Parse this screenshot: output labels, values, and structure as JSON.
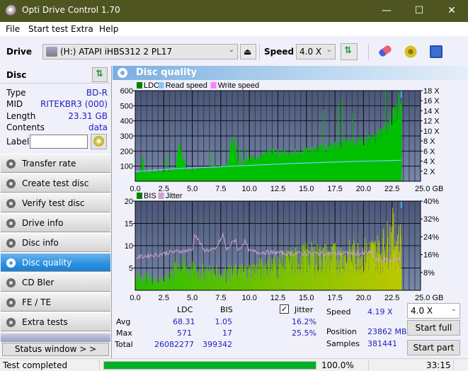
{
  "window": {
    "title": "Opti Drive Control 1.70",
    "controls": [
      "minimize",
      "maximize",
      "close"
    ]
  },
  "menu": [
    "File",
    "Start test",
    "Extra",
    "Help"
  ],
  "toolbar": {
    "drive_label": "Drive",
    "drive_value": "(H:)  ATAPI iHBS312  2 PL17",
    "speed_label": "Speed",
    "speed_value": "4.0 X",
    "icons": [
      "eject-icon",
      "refresh-icon",
      "eraser-icon",
      "config-icon",
      "save-icon"
    ]
  },
  "disc": {
    "title": "Disc",
    "rows": [
      {
        "key": "Type",
        "value": "BD-R"
      },
      {
        "key": "MID",
        "value": "RITEKBR3 (000)"
      },
      {
        "key": "Length",
        "value": "23.31 GB"
      },
      {
        "key": "Contents",
        "value": "data"
      }
    ],
    "label_key": "Label",
    "label_value": ""
  },
  "nav": [
    {
      "label": "Transfer rate",
      "active": false
    },
    {
      "label": "Create test disc",
      "active": false
    },
    {
      "label": "Verify test disc",
      "active": false
    },
    {
      "label": "Drive info",
      "active": false
    },
    {
      "label": "Disc info",
      "active": false
    },
    {
      "label": "Disc quality",
      "active": true
    },
    {
      "label": "CD Bler",
      "active": false
    },
    {
      "label": "FE / TE",
      "active": false
    },
    {
      "label": "Extra tests",
      "active": false
    }
  ],
  "status_window_label": "Status window > >",
  "panel_title": "Disc quality",
  "chart_data": [
    {
      "type": "area",
      "title": "LDC / Read speed",
      "legend": [
        "LDC",
        "Read speed",
        "Write speed"
      ],
      "legend_colors": [
        "#008000",
        "#80c8ff",
        "#ff80ff"
      ],
      "xlabel": "GB",
      "x_ticks": [
        "0.0",
        "2.5",
        "5.0",
        "7.5",
        "10.0",
        "12.5",
        "15.0",
        "17.5",
        "20.0",
        "22.5",
        "25.0 GB"
      ],
      "xlim": [
        0,
        25
      ],
      "y_ticks_left": [
        "100",
        "200",
        "300",
        "400",
        "500",
        "600"
      ],
      "ylim_left": [
        0,
        600
      ],
      "y_ticks_right": [
        "2 X",
        "4 X",
        "6 X",
        "8 X",
        "10 X",
        "12 X",
        "14 X",
        "16 X",
        "18 X"
      ],
      "ylim_right": [
        0,
        18
      ],
      "series": [
        {
          "name": "LDC",
          "x": [
            0,
            0.5,
            0.65,
            0.8,
            1.5,
            2.5,
            3.5,
            3.8,
            4.5,
            5.0,
            6.0,
            7.0,
            8.0,
            8.6,
            9.0,
            9.5,
            10.0,
            11.0,
            12.0,
            12.5,
            13.0,
            14.0,
            15.0,
            16.0,
            17.0,
            18.0,
            19.0,
            20.0,
            21.0,
            21.5,
            22.0,
            22.5,
            23.0,
            23.31
          ],
          "y": [
            55,
            60,
            185,
            60,
            65,
            70,
            80,
            250,
            75,
            80,
            90,
            95,
            105,
            300,
            110,
            130,
            150,
            165,
            200,
            190,
            180,
            190,
            200,
            210,
            225,
            240,
            255,
            270,
            290,
            320,
            340,
            420,
            480,
            571
          ]
        },
        {
          "name": "Read speed",
          "x": [
            0,
            1,
            2,
            3,
            4,
            5,
            6,
            7,
            8,
            9,
            10,
            11,
            12,
            13,
            14,
            15,
            16,
            17,
            18,
            19,
            20,
            21,
            22,
            23,
            23.31
          ],
          "y": [
            1.95,
            2.1,
            2.25,
            2.4,
            2.55,
            2.65,
            2.75,
            2.85,
            2.95,
            3.05,
            3.15,
            3.25,
            3.35,
            3.45,
            3.55,
            3.62,
            3.7,
            3.78,
            3.85,
            3.92,
            3.98,
            4.05,
            4.1,
            4.15,
            4.19
          ]
        }
      ]
    },
    {
      "type": "area",
      "title": "BIS / Jitter",
      "legend": [
        "BIS",
        "Jitter"
      ],
      "legend_colors": [
        "#008000",
        "#d0a0d0"
      ],
      "xlabel": "GB",
      "x_ticks": [
        "0.0",
        "2.5",
        "5.0",
        "7.5",
        "10.0",
        "12.5",
        "15.0",
        "17.5",
        "20.0",
        "22.5",
        "25.0 GB"
      ],
      "xlim": [
        0,
        25
      ],
      "y_ticks_left": [
        "5",
        "10",
        "15",
        "20"
      ],
      "ylim_left": [
        0,
        20
      ],
      "y_ticks_right": [
        "8%",
        "16%",
        "24%",
        "32%",
        "40%"
      ],
      "ylim_right": [
        0,
        40
      ],
      "series": [
        {
          "name": "BIS",
          "x": [
            0,
            2.5,
            3.8,
            5.0,
            7.5,
            10.0,
            12.5,
            15.0,
            17.5,
            20.0,
            21.5,
            22.5,
            23.0,
            23.31
          ],
          "y": [
            4,
            3,
            8,
            6,
            5,
            6,
            8,
            10,
            10,
            11,
            12,
            17,
            14,
            15
          ]
        },
        {
          "name": "Jitter",
          "x": [
            0,
            1,
            2,
            3,
            4,
            5,
            5.2,
            6,
            7,
            7.7,
            8,
            8.8,
            9,
            9.6,
            10,
            11,
            12,
            13,
            14,
            15,
            16,
            17,
            18,
            19,
            20,
            20.8,
            21.0,
            22,
            23,
            23.3
          ],
          "y": [
            14.5,
            15.5,
            16,
            17,
            17.5,
            18,
            25.5,
            18,
            18,
            25,
            18,
            23,
            17.5,
            22,
            17.5,
            17,
            17,
            16.5,
            16.5,
            16.5,
            16.5,
            16.5,
            16.5,
            16.5,
            16.5,
            17,
            13.5,
            13.5,
            14,
            14
          ]
        }
      ]
    }
  ],
  "stats": {
    "headers": [
      "LDC",
      "BIS"
    ],
    "jitter_label": "Jitter",
    "jitter_checked": true,
    "rows": [
      {
        "label": "Avg",
        "ldc": "68.31",
        "bis": "1.05",
        "jitter": "16.2%"
      },
      {
        "label": "Max",
        "ldc": "571",
        "bis": "17",
        "jitter": "25.5%"
      },
      {
        "label": "Total",
        "ldc": "26082277",
        "bis": "399342",
        "jitter": ""
      }
    ],
    "speed_label": "Speed",
    "speed_value": "4.19 X",
    "position_label": "Position",
    "position_value": "23862 MB",
    "samples_label": "Samples",
    "samples_value": "381441",
    "speed_select": "4.0 X",
    "start_full": "Start full",
    "start_part": "Start part"
  },
  "statusbar": {
    "text": "Test completed",
    "progress": 100.0,
    "progress_label": "100.0%",
    "time": "33:15"
  }
}
